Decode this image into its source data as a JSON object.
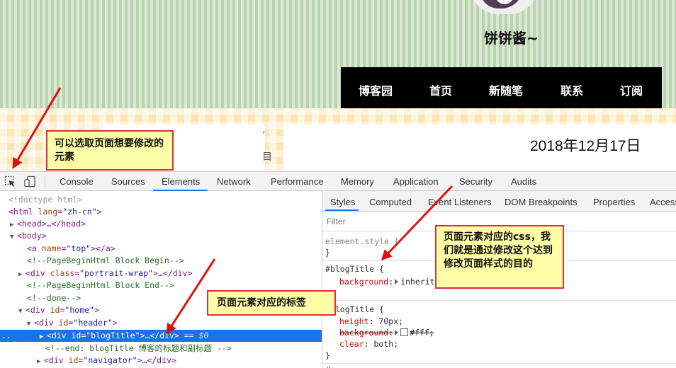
{
  "blog": {
    "title": "饼饼酱~",
    "nav": [
      "博客园",
      "首页",
      "新随笔",
      "联系",
      "订阅"
    ],
    "date": "2018年12月17日",
    "left_card_cut_top": "’",
    "left_card_cut_bottom": "目"
  },
  "devtools": {
    "tabs": [
      "Console",
      "Sources",
      "Elements",
      "Network",
      "Performance",
      "Memory",
      "Application",
      "Security",
      "Audits"
    ],
    "active_tab": "Elements",
    "dom": {
      "doctype": "<!doctype html>",
      "html_tag": "<html ",
      "html_attr": "lang",
      "html_val": "\"zh-cn\"",
      "html_close": ">",
      "head": "<head>…</head>",
      "body": "<body>",
      "a_open": "<a ",
      "a_attr": "name",
      "a_val": "\"top\"",
      "a_close": "></a>",
      "comment1": "<!--PageBeginHtml Block Begin-->",
      "div_portrait_open": "<div ",
      "div_portrait_attr": "class",
      "div_portrait_val": "\"portrait-wrap\"",
      "div_portrait_close": ">…</div>",
      "comment2": "<!--PageBeginHtml Block End-->",
      "comment3": "<!--done-->",
      "div_home_open": "<div ",
      "div_home_attr": "id",
      "div_home_val": "\"home\"",
      "div_home_close": ">",
      "div_header_open": "<div ",
      "div_header_attr": "id",
      "div_header_val": "\"header\"",
      "div_header_close": ">",
      "sel_prefix": "..",
      "div_blogtitle_open": "<div ",
      "div_blogtitle_attr": "id",
      "div_blogtitle_val": "\"blogTitle\"",
      "div_blogtitle_close": ">…</div>",
      "sel_eq": " == $0",
      "comment4": "<!--end: blogTitle 博客的标题和副标题 -->",
      "div_nav_open": "<div ",
      "div_nav_attr": "id",
      "div_nav_val": "\"navigator\"",
      "div_nav_close": ">…</div>"
    },
    "styles": {
      "subtabs": [
        "Styles",
        "Computed",
        "Event Listeners",
        "DOM Breakpoints",
        "Properties",
        "Access"
      ],
      "filter_placeholder": "Filter",
      "element_style": "element.style {",
      "close_brace": "}",
      "rule1_selector": "#blogTitle {",
      "rule1_prop": "background",
      "rule1_val": "inherit",
      "rule2_selector": "#blogTitle {",
      "rule2_prop_height": "height",
      "rule2_val_height": "70px;",
      "rule2_prop_bg": "background",
      "rule2_val_bg": "#fff;",
      "rule2_prop_clear": "clear",
      "rule2_val_clear": "both;",
      "rule3_selector": "#",
      "colon": ":"
    }
  },
  "annotations": {
    "select_tip": "可以选取页面想要修改的元素",
    "tag_tip": "页面元素对应的标签",
    "css_tip": "页面元素对应的css，我们就是通过修改这个达到修改页面样式的目的"
  },
  "colors": {
    "accent": "#1a73e8",
    "callout_border": "#d33333",
    "callout_fill": "#ffffa8",
    "arrow": "#dd1111"
  }
}
